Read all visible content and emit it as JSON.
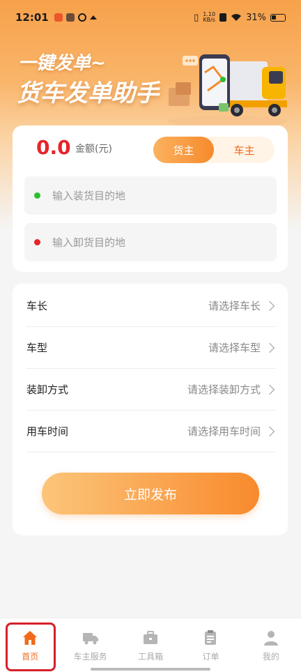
{
  "status_bar": {
    "time": "12:01",
    "net_speed_value": "1.10",
    "net_speed_unit": "KB/s",
    "battery": "31%"
  },
  "hero": {
    "slogan_small": "一键发单~",
    "slogan_big": "货车发单助手"
  },
  "amount": {
    "value": "0.0",
    "label": "金额(元)"
  },
  "role_toggle": {
    "options": [
      "货主",
      "车主"
    ],
    "selected": "货主"
  },
  "address": {
    "load_placeholder": "输入装货目的地",
    "unload_placeholder": "输入卸货目的地",
    "load_dot_color": "#2bc02f",
    "unload_dot_color": "#e4252a"
  },
  "options": [
    {
      "label": "车长",
      "value": "请选择车长"
    },
    {
      "label": "车型",
      "value": "请选择车型"
    },
    {
      "label": "装卸方式",
      "value": "请选择装卸方式"
    },
    {
      "label": "用车时间",
      "value": "请选择用车时间"
    }
  ],
  "publish_button": "立即发布",
  "tabbar": [
    {
      "label": "首页",
      "icon": "home-icon",
      "active": true
    },
    {
      "label": "车主服务",
      "icon": "truck-icon",
      "active": false
    },
    {
      "label": "工具箱",
      "icon": "toolbox-icon",
      "active": false
    },
    {
      "label": "订单",
      "icon": "clipboard-icon",
      "active": false
    },
    {
      "label": "我的",
      "icon": "user-icon",
      "active": false
    }
  ],
  "colors": {
    "accent": "#f78a2c",
    "accent_text": "#f26a1b",
    "amount": "#e4252a"
  }
}
